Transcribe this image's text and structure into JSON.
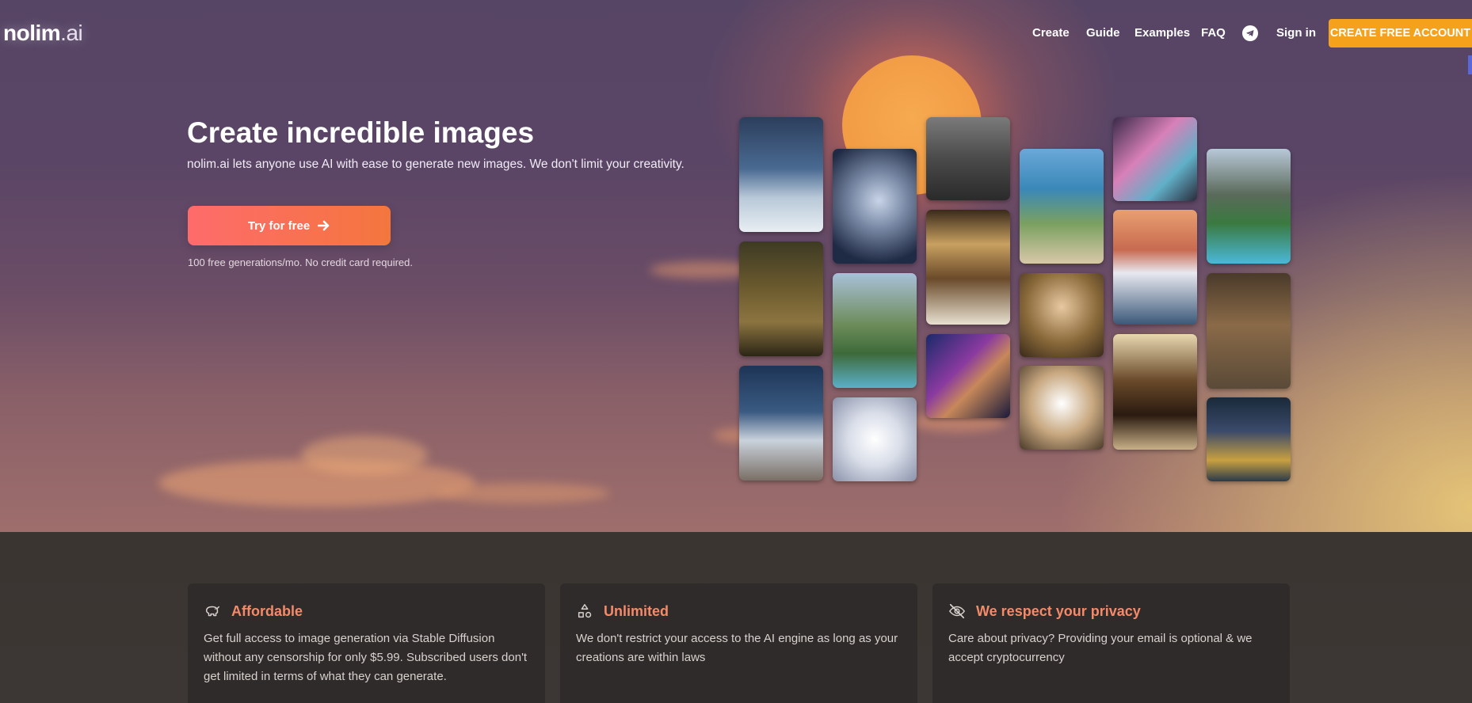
{
  "brand": {
    "name": "nolim",
    "tld": ".ai"
  },
  "nav": {
    "items": [
      {
        "label": "Create"
      },
      {
        "label": "Guide"
      },
      {
        "label": "Examples"
      },
      {
        "label": "FAQ"
      }
    ],
    "telegram_icon": "telegram-icon",
    "signin_label": "Sign in",
    "cta_label": "CREATE FREE ACCOUNT"
  },
  "hero": {
    "headline": "Create incredible images",
    "subline": "nolim.ai lets anyone use AI with ease to generate new images. We don't limit your creativity.",
    "button_label": "Try for free",
    "note": "100 free generations/mo. No credit card required."
  },
  "gallery": {
    "images": [
      "mountain-night-image",
      "monkey-family-portrait-image",
      "snowy-peaks-image",
      "robot-woman-image",
      "glass-house-pool-image",
      "white-haired-woman-image",
      "man-ruined-city-image",
      "chandelier-lobby-image",
      "cyberpunk-bearded-man-image",
      "coastal-villa-image",
      "renaissance-woman-image",
      "dog-bunny-hat-image",
      "pastel-hair-girl-image",
      "red-mountains-image",
      "luxury-hallway-image",
      "modern-house-pool-image",
      "monkey-group-image",
      "night-city-image"
    ]
  },
  "features": [
    {
      "icon": "piggy-bank-icon",
      "title": "Affordable",
      "body": "Get full access to image generation via Stable Diffusion without any censorship for only $5.99. Subscribed users don't get limited in terms of what they can generate."
    },
    {
      "icon": "shapes-icon",
      "title": "Unlimited",
      "body": "We don't restrict your access to the AI engine as long as your creations are within laws"
    },
    {
      "icon": "eye-slash-icon",
      "title": "We respect your privacy",
      "body": "Care about privacy? Providing your email is optional & we accept cryptocurrency"
    }
  ],
  "colors": {
    "accent_orange": "#f5a11b",
    "feature_title": "#f58a6a",
    "button_start": "#fe6b6b",
    "button_end": "#f4763e"
  }
}
